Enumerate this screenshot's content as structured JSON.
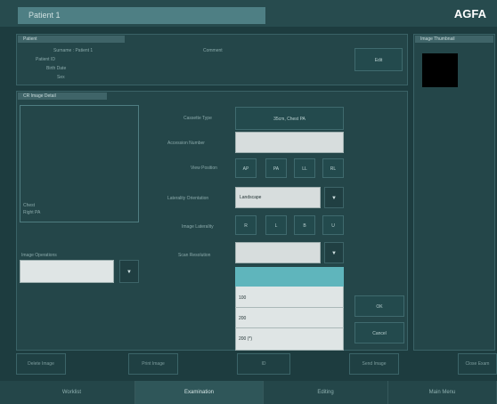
{
  "topbar": {
    "patient": "Patient 1",
    "brand": "AGFA"
  },
  "patient_panel": {
    "title": "Patient",
    "fields": [
      "Surname : Patient 1",
      "Patient ID",
      "Birth Date",
      "Sex"
    ],
    "right_field": "Comment",
    "edit_label": "Edit"
  },
  "preview_panel": {
    "title": "Image Thumbnail"
  },
  "cr_panel": {
    "title": "CR Image Detail",
    "preview_lines": [
      "Chest",
      "Right PA"
    ],
    "exposure_label": "Image Operations",
    "rows": [
      {
        "label": "Cassette Type",
        "value": "35cm, Chest PA"
      },
      {
        "label": "Accession Number",
        "value": ""
      },
      {
        "label": "View Position",
        "value": ""
      },
      {
        "label": "Laterality Orientation",
        "value": "Landscape"
      },
      {
        "label": "Image Laterality",
        "value": ""
      },
      {
        "label": "Scan Resolution",
        "value": ""
      }
    ],
    "view_buttons": [
      "AP",
      "PA",
      "LL",
      "RL"
    ],
    "lat_buttons": [
      "R",
      "L",
      "B",
      "U"
    ]
  },
  "dropdown_list": {
    "items": [
      "",
      "100",
      "200",
      "200 (*)"
    ]
  },
  "dialog_buttons": {
    "ok": "OK",
    "cancel": "Cancel"
  },
  "action_row": [
    "Delete Image",
    "Print Image",
    "ID",
    "Send Image",
    "Close Exam"
  ],
  "bottom_tabs": [
    "Worklist",
    "Examination",
    "Editing",
    "Main Menu"
  ]
}
